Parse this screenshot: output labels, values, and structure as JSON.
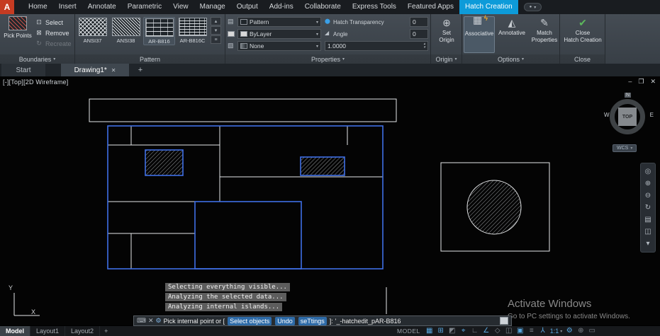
{
  "app": {
    "logo_letter": "A"
  },
  "menubar": {
    "items": [
      "Home",
      "Insert",
      "Annotate",
      "Parametric",
      "View",
      "Manage",
      "Output",
      "Add-ins",
      "Collaborate",
      "Express Tools",
      "Featured Apps"
    ],
    "active_tab": "Hatch Creation"
  },
  "ribbon": {
    "boundaries": {
      "title": "Boundaries",
      "pick_points": "Pick Points",
      "select": "Select",
      "remove": "Remove",
      "recreate": "Recreate"
    },
    "pattern": {
      "title": "Pattern",
      "swatches": [
        "ANSI37",
        "ANSI38",
        "AR-B816",
        "AR-B816C"
      ]
    },
    "properties": {
      "title": "Properties",
      "pattern_dropdown": "Pattern",
      "bylayer_dropdown": "ByLayer",
      "none_dropdown": "None",
      "transparency_label": "Hatch Transparency",
      "transparency_value": "0",
      "angle_label": "Angle",
      "angle_value": "0",
      "scale_value": "1.0000"
    },
    "origin": {
      "title": "Origin",
      "line1": "Set",
      "line2": "Origin"
    },
    "options": {
      "title": "Options",
      "associative": "Associative",
      "annotative": "Annotative",
      "match_line1": "Match",
      "match_line2": "Properties"
    },
    "close_panel": {
      "title": "Close",
      "line1": "Close",
      "line2": "Hatch Creation"
    }
  },
  "file_tabs": {
    "start": "Start",
    "active": "Drawing1*"
  },
  "viewport": {
    "controls_label": "[-][Top][2D Wireframe]",
    "compass": {
      "n": "N",
      "w": "W",
      "e": "E",
      "center": "TOP"
    },
    "wcs": "WCS",
    "ucs_x": "X",
    "ucs_y": "Y"
  },
  "command": {
    "history": [
      "Selecting everything visible...",
      "Analyzing the selected data...",
      "Analyzing internal islands..."
    ],
    "prompt_pre": "Pick internal point or [",
    "kw_select": "Select objects",
    "kw_undo": "Undo",
    "kw_settings": "seTtings",
    "prompt_post": "]:",
    "entry": "'_-hatchedit_pAR-B816"
  },
  "statusbar": {
    "tabs": [
      "Model",
      "Layout1",
      "Layout2"
    ],
    "model_label": "MODEL",
    "scale": "1:1"
  },
  "watermark": {
    "title": "Activate Windows",
    "subtitle": "Go to PC settings to activate Windows."
  },
  "ui": {
    "caret": "▾",
    "close": "✕",
    "plus": "+",
    "minimize": "–",
    "restore": "❐",
    "up": "▴",
    "down": "▾",
    "menu": "≡",
    "dot": "●"
  },
  "icons": {
    "select": "⊡",
    "remove": "⊠",
    "recreate": "↻",
    "droplet": "⬤",
    "angle": "◢",
    "pattern_row": "▤",
    "none_row": "▧",
    "set_origin": "⊕",
    "associative_base": "▦",
    "associative_bolt": "ϟ",
    "annotative": "◭",
    "match": "✎",
    "check": "✔",
    "keyboard": "⌨",
    "wrench": "⚙",
    "navbar": [
      "◎",
      "⊕",
      "⊖",
      "↻",
      "▤",
      "◫"
    ],
    "status": [
      {
        "name": "grid",
        "glyph": "▦"
      },
      {
        "name": "snap",
        "glyph": "⊞"
      },
      {
        "name": "infer",
        "glyph": "◩"
      },
      {
        "name": "dynamic-input",
        "glyph": "⌖"
      },
      {
        "name": "ortho",
        "glyph": "∟"
      },
      {
        "name": "polar",
        "glyph": "∠"
      },
      {
        "name": "isodraft",
        "glyph": "◇"
      },
      {
        "name": "otrack",
        "glyph": "◫"
      },
      {
        "name": "osnap",
        "glyph": "▣"
      },
      {
        "name": "lineweight",
        "glyph": "≡"
      },
      {
        "name": "annotation-visibility",
        "glyph": "⅄"
      },
      {
        "name": "gear",
        "glyph": "⚙"
      },
      {
        "name": "annotation-monitor",
        "glyph": "⊕"
      },
      {
        "name": "clean-screen",
        "glyph": "▭"
      }
    ]
  }
}
